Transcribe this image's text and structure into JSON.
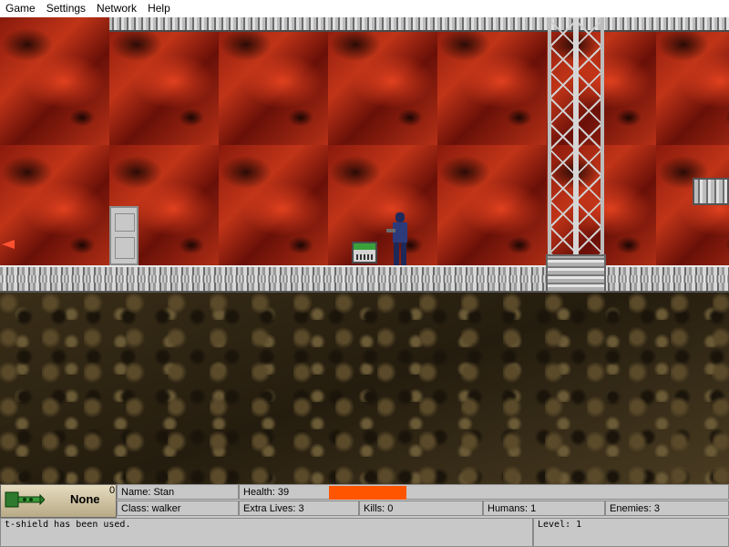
{
  "menu": [
    "Game",
    "Settings",
    "Network",
    "Help"
  ],
  "hud": {
    "weapon_icon": "t-shield-icon",
    "weapon_name": "None",
    "weapon_count": "0",
    "name": "Name: Stan",
    "class": "Class: walker",
    "health": "Health: 39",
    "health_level": 39,
    "health_bar_color": "#ff5500",
    "extra_lives": "Extra Lives: 3",
    "kills": "Kills: 0",
    "humans": "Humans: 1",
    "enemies": "Enemies: 3"
  },
  "console": {
    "message": "t-shield has been used.",
    "level": "Level: 1"
  }
}
